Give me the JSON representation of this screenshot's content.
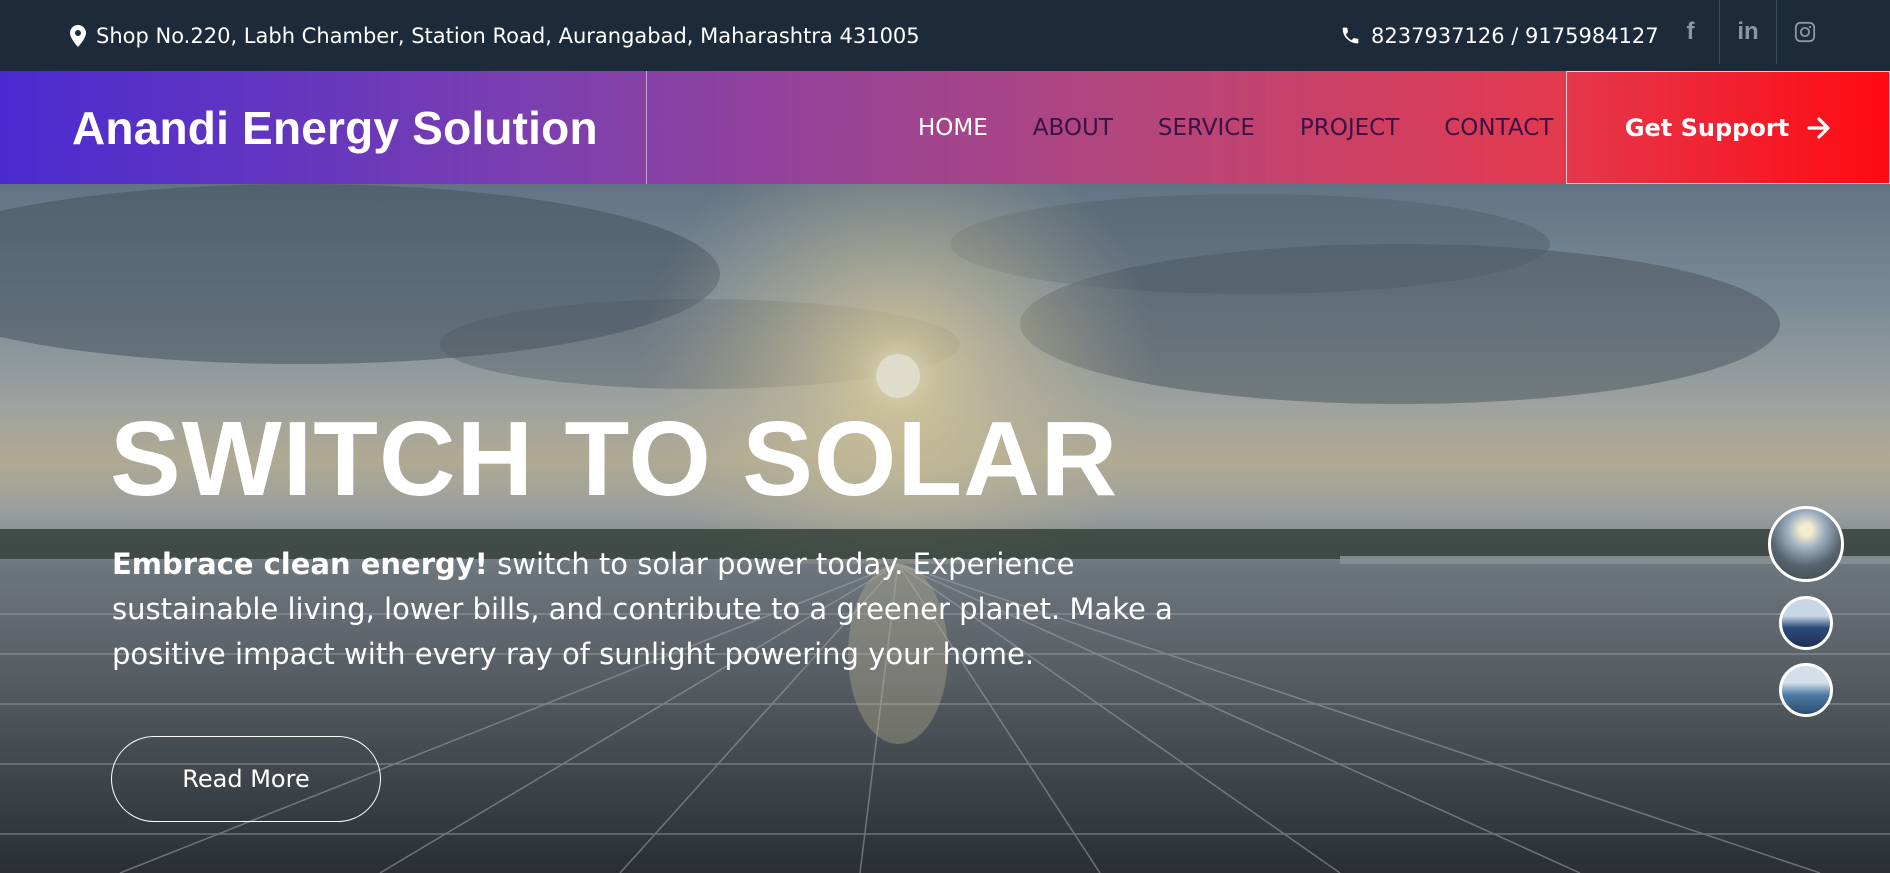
{
  "topbar": {
    "address": "Shop No.220, Labh Chamber, Station Road, Aurangabad, Maharashtra 431005",
    "phone": "8237937126 / 9175984127",
    "socials": [
      {
        "name": "facebook-icon",
        "glyph": "f"
      },
      {
        "name": "linkedin-icon",
        "glyph": "in"
      },
      {
        "name": "instagram-icon",
        "glyph": "◎"
      }
    ]
  },
  "header": {
    "brand": "Anandi Energy Solution",
    "nav": [
      "HOME",
      "ABOUT",
      "SERVICE",
      "PROJECT",
      "CONTACT"
    ],
    "support_label": "Get Support"
  },
  "hero": {
    "title": "SWITCH TO SOLAR",
    "lead_bold": "Embrace clean energy!",
    "lead_rest": " switch to solar power today. Experience sustainable living, lower bills, and contribute to a greener planet. Make a positive impact with every ray of sunlight powering your home.",
    "button": "Read More"
  },
  "colors": {
    "topbar": "#1c2a3a",
    "gradient_start": "#4a2bd0",
    "gradient_end": "#ff0a12",
    "nav_inactive": "#3a1244"
  }
}
